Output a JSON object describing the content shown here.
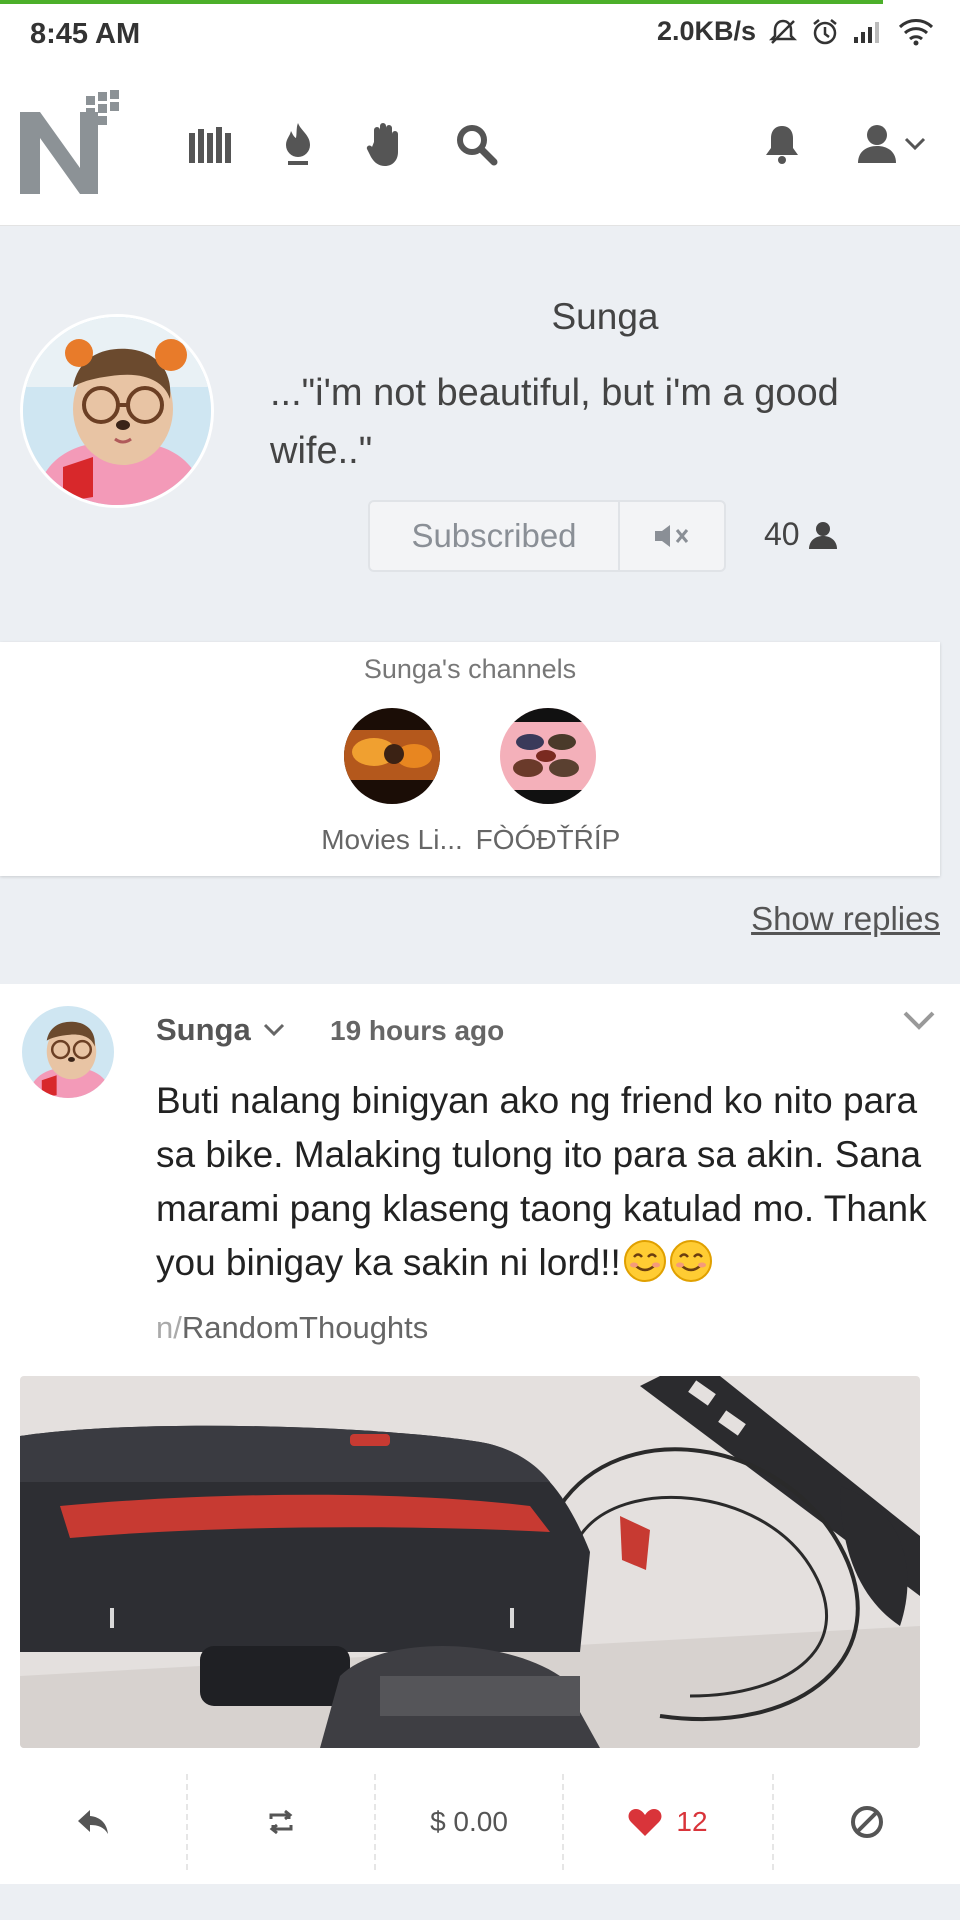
{
  "status_bar": {
    "time": "8:45 AM",
    "speed": "2.0KB/s",
    "progress_percent": 92,
    "icons": [
      "notifications-off-icon",
      "alarm-icon",
      "signal-icon",
      "wifi-icon"
    ]
  },
  "nav": {
    "logo": "N",
    "icons": [
      "library-icon",
      "fire-icon",
      "hand-icon",
      "search-icon",
      "bell-icon",
      "user-icon",
      "chevron-down-icon"
    ]
  },
  "profile": {
    "name": "Sunga",
    "bio": "...\"i'm not beautiful, but i'm a good wife..\"",
    "subscribe_label": "Subscribed",
    "subscribers": "40"
  },
  "channels": {
    "title": "Sunga's channels",
    "items": [
      {
        "label": "Movies Li..."
      },
      {
        "label": "FÒÓĐŤŔÍP"
      }
    ]
  },
  "show_replies": "Show replies",
  "post": {
    "author": "Sunga",
    "time": "19 hours ago",
    "text": "Buti nalang binigyan ako ng friend ko nito para sa bike. Malaking tulong ito para sa akin. Sana marami pang klaseng taong katulad mo. Thank you binigay ka sakin ni lord!!",
    "tag_prefix": "n/",
    "tag": "RandomThoughts",
    "wire_amount": "$ 0.00",
    "likes": "12"
  },
  "colors": {
    "accent_green": "#4caf2a",
    "like_red": "#d9343a",
    "background": "#eceff3"
  }
}
